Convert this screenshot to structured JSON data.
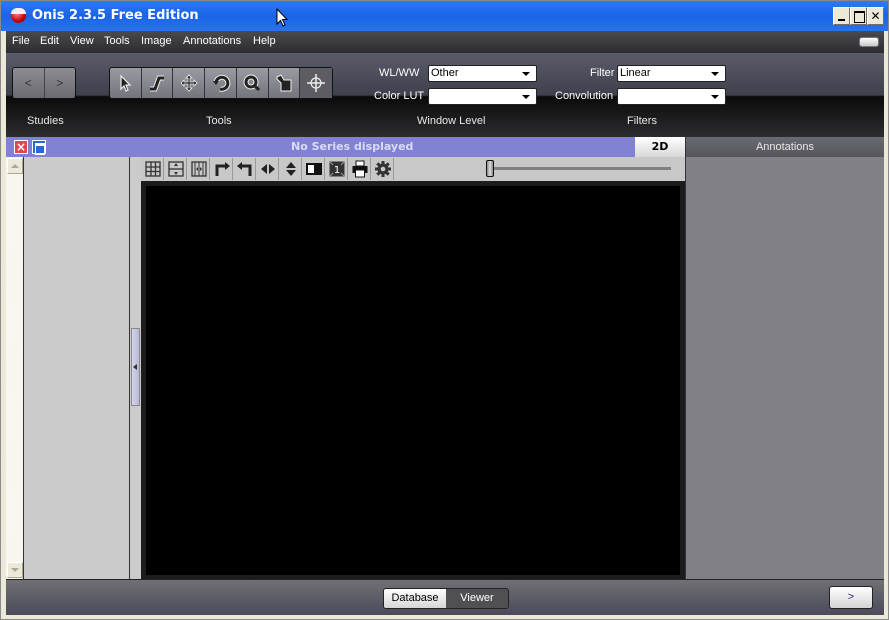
{
  "window": {
    "title": "Onis 2.3.5 Free Edition",
    "controls": {
      "minimize": "_",
      "maximize": "□",
      "close": "✕"
    }
  },
  "menubar": {
    "items": [
      "File",
      "Edit",
      "View",
      "Tools",
      "Image",
      "Annotations",
      "Help"
    ]
  },
  "toolbar": {
    "nav": {
      "back": "<",
      "forward": ">"
    },
    "tools": [
      {
        "name": "pointer",
        "icon": "arrow-pointer-icon"
      },
      {
        "name": "window-level",
        "icon": "window-level-icon"
      },
      {
        "name": "pan",
        "icon": "move-icon"
      },
      {
        "name": "rotate",
        "icon": "rotate-icon"
      },
      {
        "name": "zoom",
        "icon": "magnifier-icon"
      },
      {
        "name": "localize",
        "icon": "localize-icon"
      },
      {
        "name": "crosshair",
        "icon": "crosshair-icon",
        "active": true
      }
    ],
    "wlww_label": "WL/WW",
    "wlww_value": "Other",
    "colorlut_label": "Color LUT",
    "colorlut_value": "",
    "filter_label": "Filter",
    "filter_value": "Linear",
    "convolution_label": "Convolution",
    "convolution_value": "",
    "captions": {
      "studies": "Studies",
      "tools": "Tools",
      "window_level": "Window Level",
      "filters": "Filters"
    }
  },
  "series_bar": {
    "message": "No Series displayed",
    "mode_tab": "2D",
    "close_icon": "×",
    "accent": "#8282d4"
  },
  "annotations_panel": {
    "title": "Annotations"
  },
  "viewer_tools": [
    "layout-grid-icon",
    "split-horizontal-icon",
    "split-vertical-icon",
    "rotate-right-icon",
    "rotate-left-icon",
    "flip-horizontal-icon",
    "flip-vertical-icon",
    "invert-icon",
    "frame-number-icon",
    "print-icon",
    "settings-gear-icon"
  ],
  "viewer": {
    "frame_badge": "1",
    "slider_value": 0
  },
  "bottom_bar": {
    "database_label": "Database",
    "viewer_label": "Viewer",
    "active": "Viewer",
    "next_label": ">"
  }
}
